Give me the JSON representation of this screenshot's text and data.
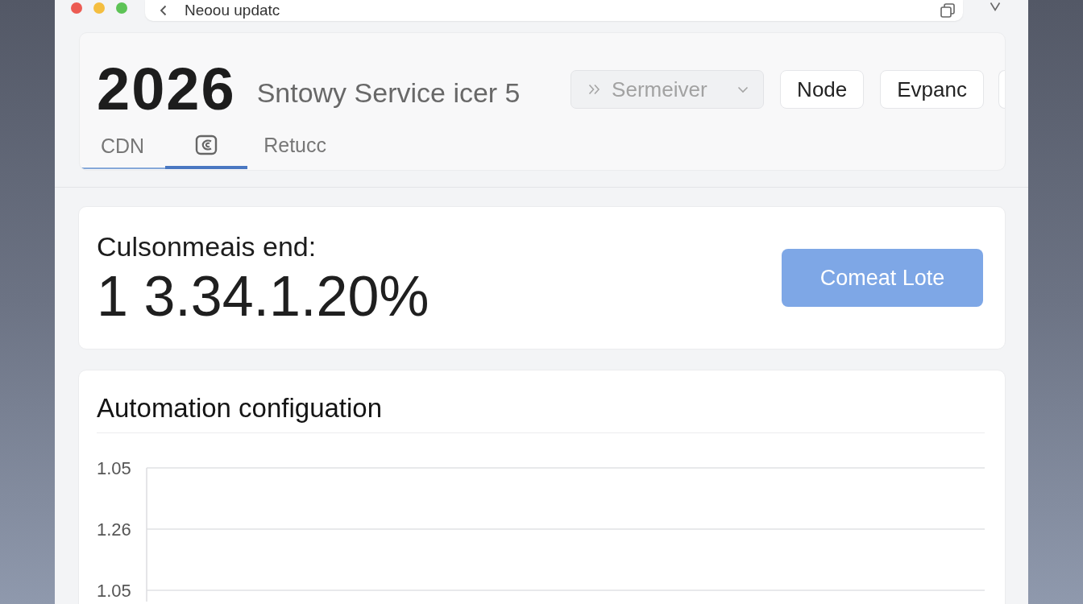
{
  "window": {
    "address_bar": {
      "text": "Neoou updatc"
    }
  },
  "header": {
    "title": "2026",
    "subtitle": "Sntowy Service icer 5",
    "select": {
      "value": "Sermeiver"
    },
    "buttons": [
      {
        "label": "Node"
      },
      {
        "label": "Evpanc"
      }
    ],
    "tabs": [
      {
        "kind": "text",
        "label": "CDN",
        "selected": false,
        "hovered": true
      },
      {
        "kind": "icon",
        "selected": true,
        "hovered": false
      },
      {
        "kind": "text",
        "label": "Retucc",
        "selected": false,
        "hovered": false
      }
    ]
  },
  "summary_card": {
    "label": "Culsonmeais end:",
    "value": "1 3.34.1.20%",
    "button": "Comeat Lote"
  },
  "chart_card": {
    "title": "Automation configuation",
    "grid_labels": [
      "1.05",
      "1.26",
      "1.05"
    ]
  }
}
